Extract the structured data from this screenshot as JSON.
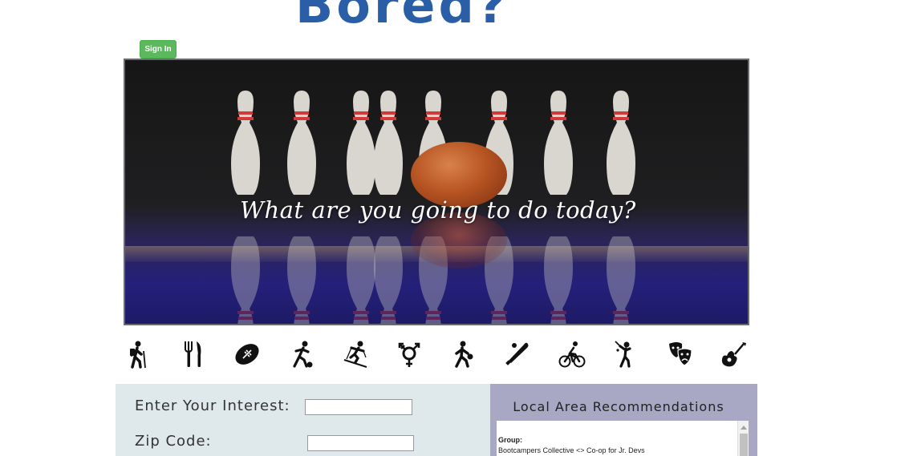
{
  "header": {
    "title": "Bored?"
  },
  "auth": {
    "sign_in_label": "Sign In"
  },
  "hero": {
    "tagline": "What are you going to do today?"
  },
  "categories": [
    {
      "icon": "hiking-icon"
    },
    {
      "icon": "fork-knife-icon"
    },
    {
      "icon": "football-icon"
    },
    {
      "icon": "soccer-icon"
    },
    {
      "icon": "skiing-icon"
    },
    {
      "icon": "gender-symbol-icon"
    },
    {
      "icon": "basketball-player-icon"
    },
    {
      "icon": "baseball-bat-icon"
    },
    {
      "icon": "cycling-icon"
    },
    {
      "icon": "golf-icon"
    },
    {
      "icon": "theater-masks-icon"
    },
    {
      "icon": "guitar-icon"
    }
  ],
  "form": {
    "interest_label": "Enter Your Interest:",
    "interest_value": "",
    "zip_label": "Zip Code:",
    "zip_value": ""
  },
  "recommendations": {
    "title": "Local Area Recommendations",
    "items": [
      {
        "type_label": "Group:",
        "name": "Bootcampers Collective <> Co-op for Jr. Devs"
      }
    ]
  },
  "colors": {
    "title": "#2a5fa8",
    "sign_in": "#5cb85c",
    "form_panel": "#dfe8ea",
    "rec_panel": "#a9a8c4"
  }
}
